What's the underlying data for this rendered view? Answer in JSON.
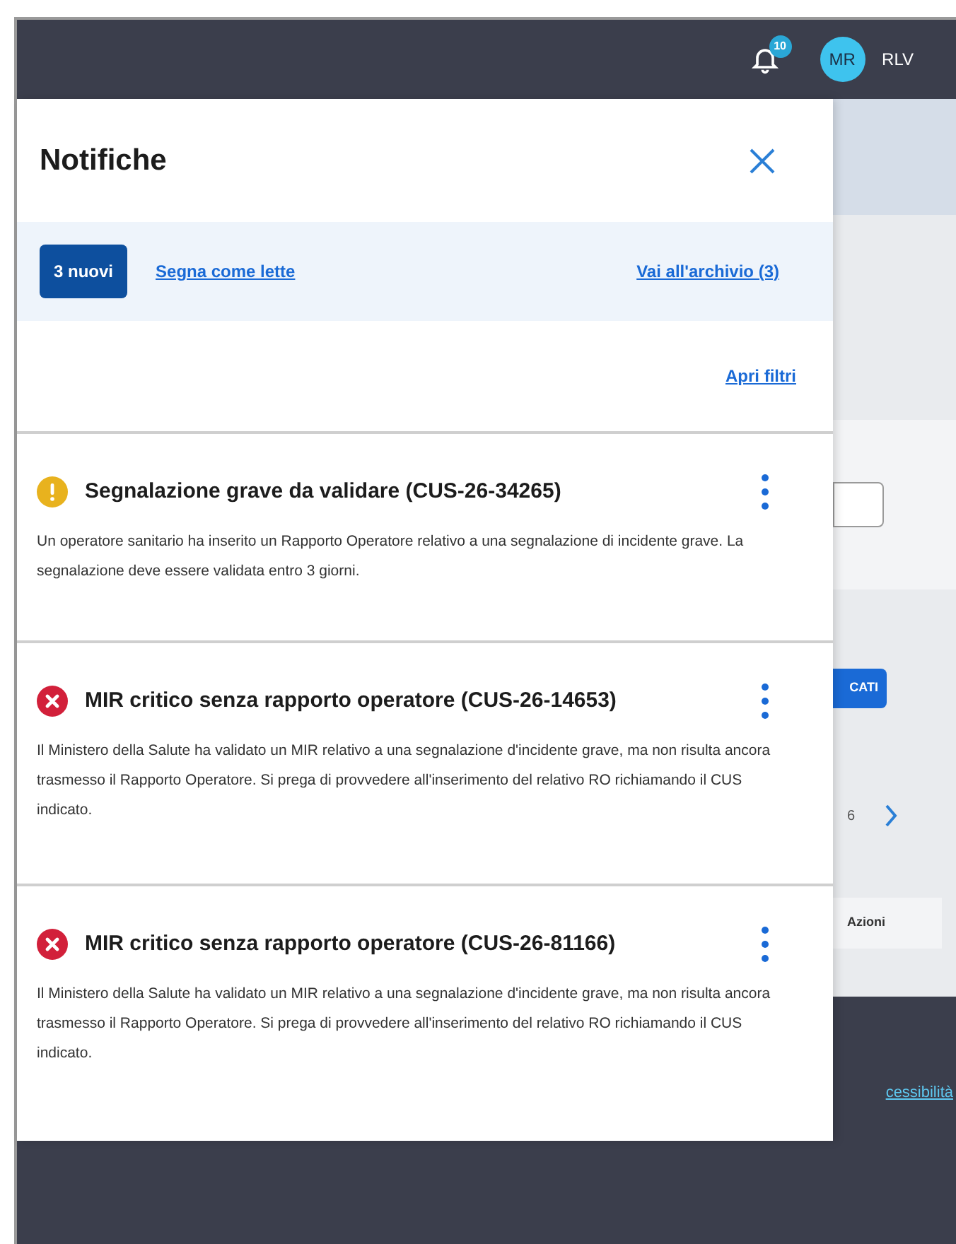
{
  "header": {
    "notification_count": "10",
    "avatar_initials": "MR",
    "user": "RLV"
  },
  "panel": {
    "title": "Notifiche",
    "new_button": "3 nuovi",
    "mark_read_link": "Segna come lette",
    "archive_link": "Vai all'archivio (3)",
    "filters_link": "Apri filtri",
    "notifications": [
      {
        "kind": "warning",
        "title": "Segnalazione grave da validare (CUS-26-34265)",
        "body": "Un operatore sanitario ha inserito un Rapporto Operatore relativo a una segnalazione di incidente grave. La segnalazione deve essere validata entro 3 giorni."
      },
      {
        "kind": "error",
        "title": "MIR critico senza rapporto operatore (CUS-26-14653)",
        "body": "Il Ministero della Salute ha validato un MIR relativo a una segnalazione d'incidente grave, ma non risulta ancora trasmesso il Rapporto Operatore. Si prega di provvedere all'inserimento del relativo RO richiamando il CUS indicato."
      },
      {
        "kind": "error",
        "title": "MIR critico senza rapporto operatore (CUS-26-81166)",
        "body": "Il Ministero della Salute ha validato un MIR relativo a una segnalazione d'incidente grave, ma non risulta ancora trasmesso il Rapporto Operatore. Si prega di provvedere all'inserimento del relativo RO richiamando il CUS indicato."
      }
    ]
  },
  "background": {
    "button_fragment": "CATI",
    "page_number": "6",
    "column_fragment": "Azioni",
    "footer_link_fragment": "cessibilità"
  }
}
